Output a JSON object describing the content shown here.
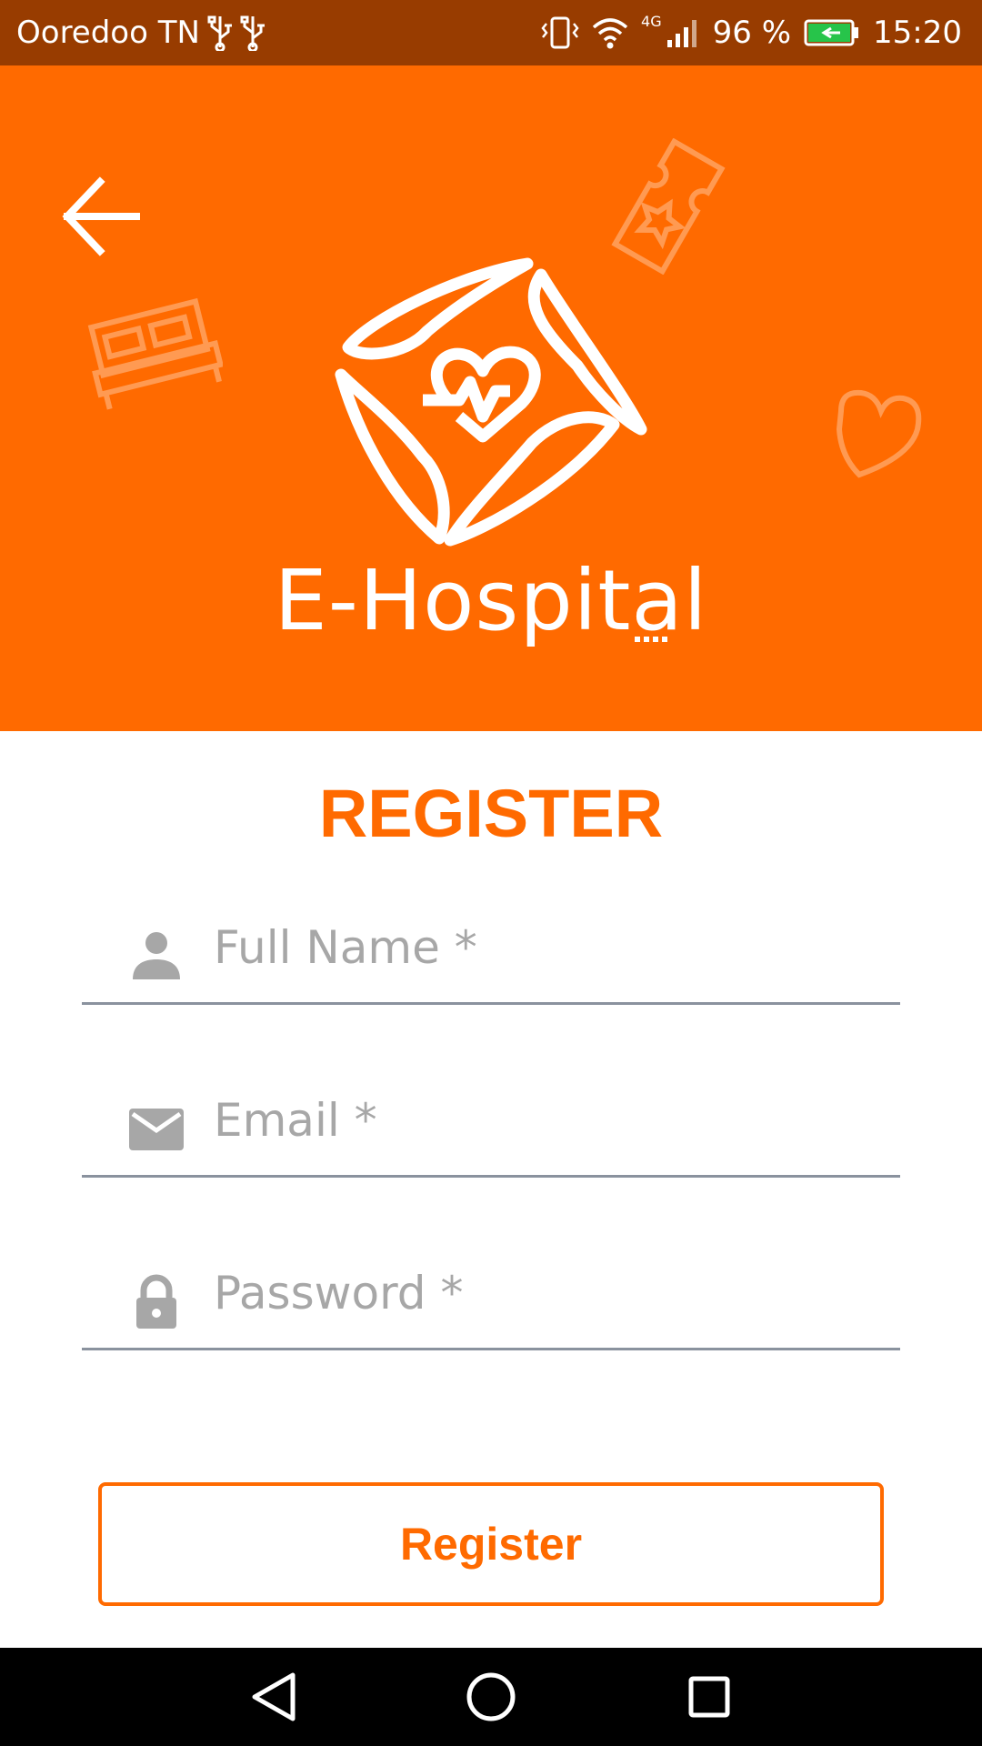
{
  "status_bar": {
    "carrier": "Ooredoo TN",
    "network_type": "4G",
    "battery": "96 %",
    "time": "15:20",
    "battery_color": "#27c44a"
  },
  "header": {
    "background_color": "#ff6a00",
    "brand_name": "E-Hospital",
    "icons": [
      "back-arrow-icon",
      "bed-icon",
      "ticket-star-icon",
      "heart-outline-icon",
      "logo-heartbeat-icon"
    ]
  },
  "form": {
    "title": "REGISTER",
    "fields": [
      {
        "icon": "person-icon",
        "placeholder": "Full Name *",
        "value": ""
      },
      {
        "icon": "mail-icon",
        "placeholder": "Email *",
        "value": ""
      },
      {
        "icon": "lock-icon",
        "placeholder": "Password *",
        "value": ""
      }
    ],
    "submit_label": "Register",
    "accent_color": "#ff6a00"
  },
  "nav_bar": {
    "icons": [
      "back-triangle-icon",
      "home-circle-icon",
      "recents-square-icon"
    ]
  }
}
